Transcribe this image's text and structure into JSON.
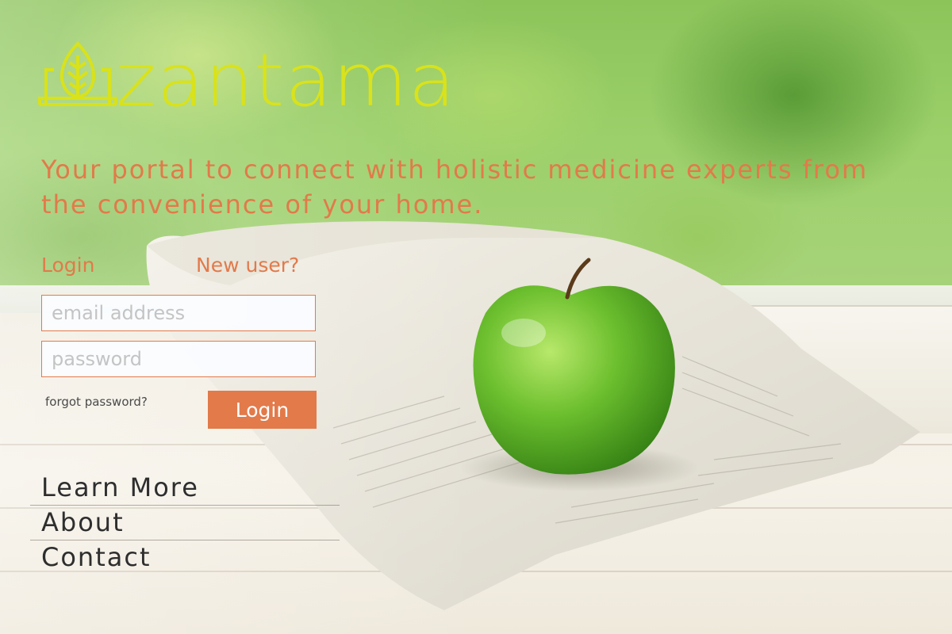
{
  "brand": {
    "name": "zantama",
    "logo_color": "#d9e21a",
    "logo_icon": "leaf-house-icon"
  },
  "tagline": "Your portal to connect with holistic medicine experts from the convenience of your home.",
  "auth": {
    "tab_login": "Login",
    "tab_new_user": "New user?",
    "email_placeholder": "email address",
    "email_value": "",
    "password_placeholder": "password",
    "password_value": "",
    "forgot_password": "forgot password?",
    "login_button": "Login"
  },
  "nav": {
    "items": [
      {
        "label": "Learn More"
      },
      {
        "label": "About"
      },
      {
        "label": "Contact"
      }
    ]
  },
  "colors": {
    "accent": "#e27a4a",
    "text_dark": "#2e2e2e"
  },
  "background_image": "green-apple-on-newspaper-by-window"
}
